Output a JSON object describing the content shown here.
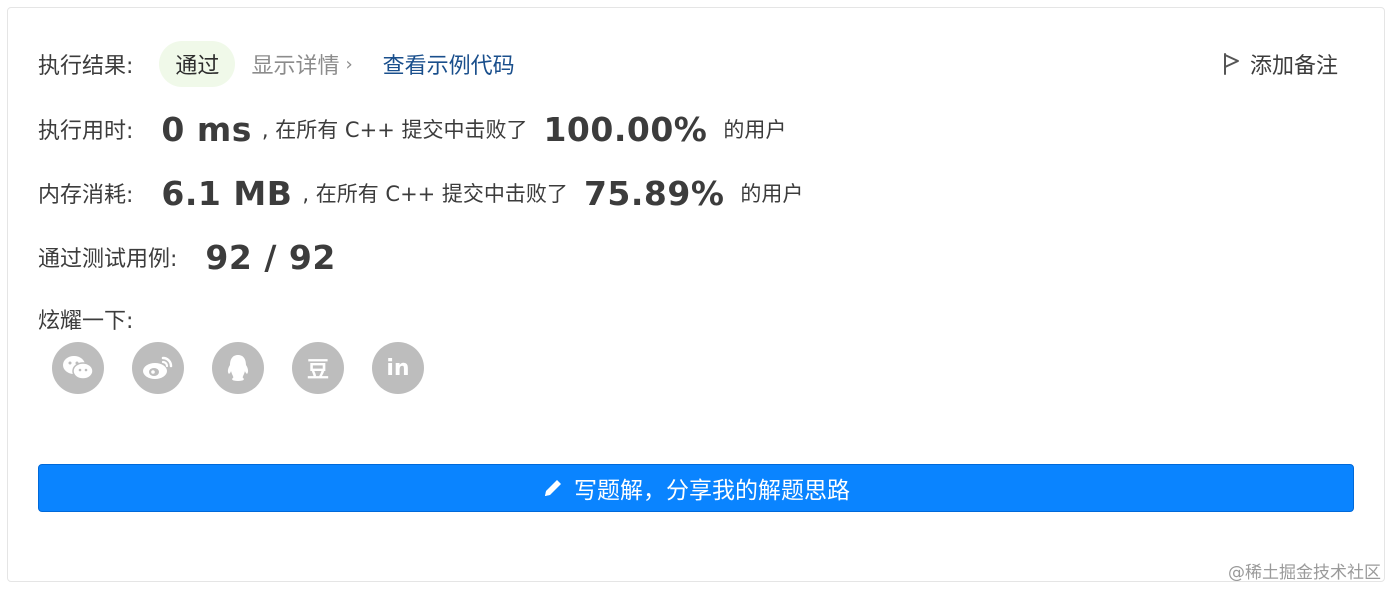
{
  "result": {
    "label": "执行结果:",
    "status": "通过",
    "details_link": "显示详情",
    "example_link": "查看示例代码",
    "add_note": "添加备注"
  },
  "runtime": {
    "label": "执行用时:",
    "value": "0 ms",
    "beat_prefix": ", 在所有 C++ 提交中击败了",
    "percent": "100.00%",
    "suffix": "的用户"
  },
  "memory": {
    "label": "内存消耗:",
    "value": "6.1 MB",
    "beat_prefix": ", 在所有 C++ 提交中击败了",
    "percent": "75.89%",
    "suffix": "的用户"
  },
  "tests": {
    "label": "通过测试用例:",
    "value": "92 / 92"
  },
  "share": {
    "label": "炫耀一下:",
    "icons": [
      "wechat-icon",
      "weibo-icon",
      "qq-icon",
      "douban-icon",
      "linkedin-icon"
    ],
    "douban_glyph": "豆",
    "linkedin_glyph": "in"
  },
  "write_solution_button": "写题解，分享我的解题思路",
  "watermark": "@稀土掘金技术社区",
  "colors": {
    "primary_button": "#0a84ff",
    "pass_badge_bg": "#f0f9e9",
    "link": "#1a4f8c",
    "share_icon_bg": "#bdbdbd"
  }
}
